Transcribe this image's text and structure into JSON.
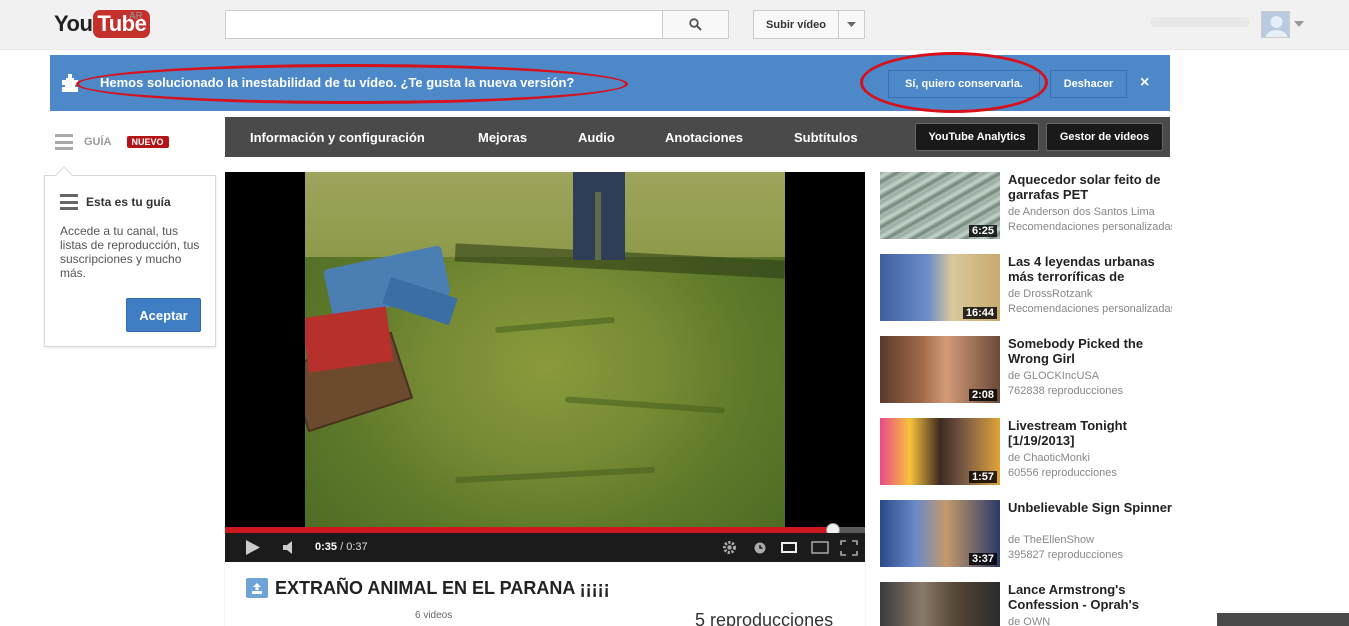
{
  "masthead": {
    "logo_you": "You",
    "logo_tube": "Tube",
    "region": "AR",
    "search_placeholder": "",
    "upload_label": "Subir vídeo"
  },
  "notification": {
    "message": "Hemos solucionado la inestabilidad de tu vídeo. ¿Te gusta la nueva versión?",
    "keep_label": "Sí, quiero conservarla.",
    "undo_label": "Deshacer",
    "close_label": "×"
  },
  "guide": {
    "label": "GUÍA",
    "badge": "NUEVO",
    "card_title": "Esta es tu guía",
    "card_text": "Accede a tu canal, tus listas de reproducción, tus suscripciones y mucho más.",
    "accept_label": "Aceptar"
  },
  "editbar": {
    "tabs": [
      "Información y configuración",
      "Mejoras",
      "Audio",
      "Anotaciones",
      "Subtítulos"
    ],
    "analytics_label": "YouTube Analytics",
    "manager_label": "Gestor de videos"
  },
  "player": {
    "current_time": "0:35",
    "separator": " / ",
    "duration": "0:37",
    "progress": 0.95
  },
  "video": {
    "title": "EXTRAÑO ANIMAL EN EL PARANA ¡¡¡¡¡",
    "video_count": "6 videos",
    "views": "5 reproducciones"
  },
  "related": [
    {
      "title": "Aquecedor solar feito de garrafas PET",
      "channel": "de Anderson dos Santos Lima",
      "meta": "Recomendaciones personalizadas",
      "duration": "6:25"
    },
    {
      "title": "Las 4 leyendas urbanas más terroríficas de",
      "channel": "de DrossRotzank",
      "meta": "Recomendaciones personalizadas",
      "duration": "16:44"
    },
    {
      "title": "Somebody Picked the Wrong Girl",
      "channel": "de GLOCKIncUSA",
      "meta": "762838 reproducciones",
      "duration": "2:08"
    },
    {
      "title": "Livestream Tonight [1/19/2013]",
      "channel": "de ChaoticMonki",
      "meta": "60556 reproducciones",
      "duration": "1:57"
    },
    {
      "title": "Unbelievable Sign Spinner",
      "channel": "de TheEllenShow",
      "meta": "395827 reproducciones",
      "duration": "3:37"
    },
    {
      "title": "Lance Armstrong's Confession - Oprah's",
      "channel": "de OWN",
      "meta": "",
      "duration": ""
    }
  ],
  "colors": {
    "notification_bg": "#4d88c8",
    "brand_red": "#c4302b",
    "progress_red": "#cc181e",
    "annotation_red": "#d8101a"
  }
}
